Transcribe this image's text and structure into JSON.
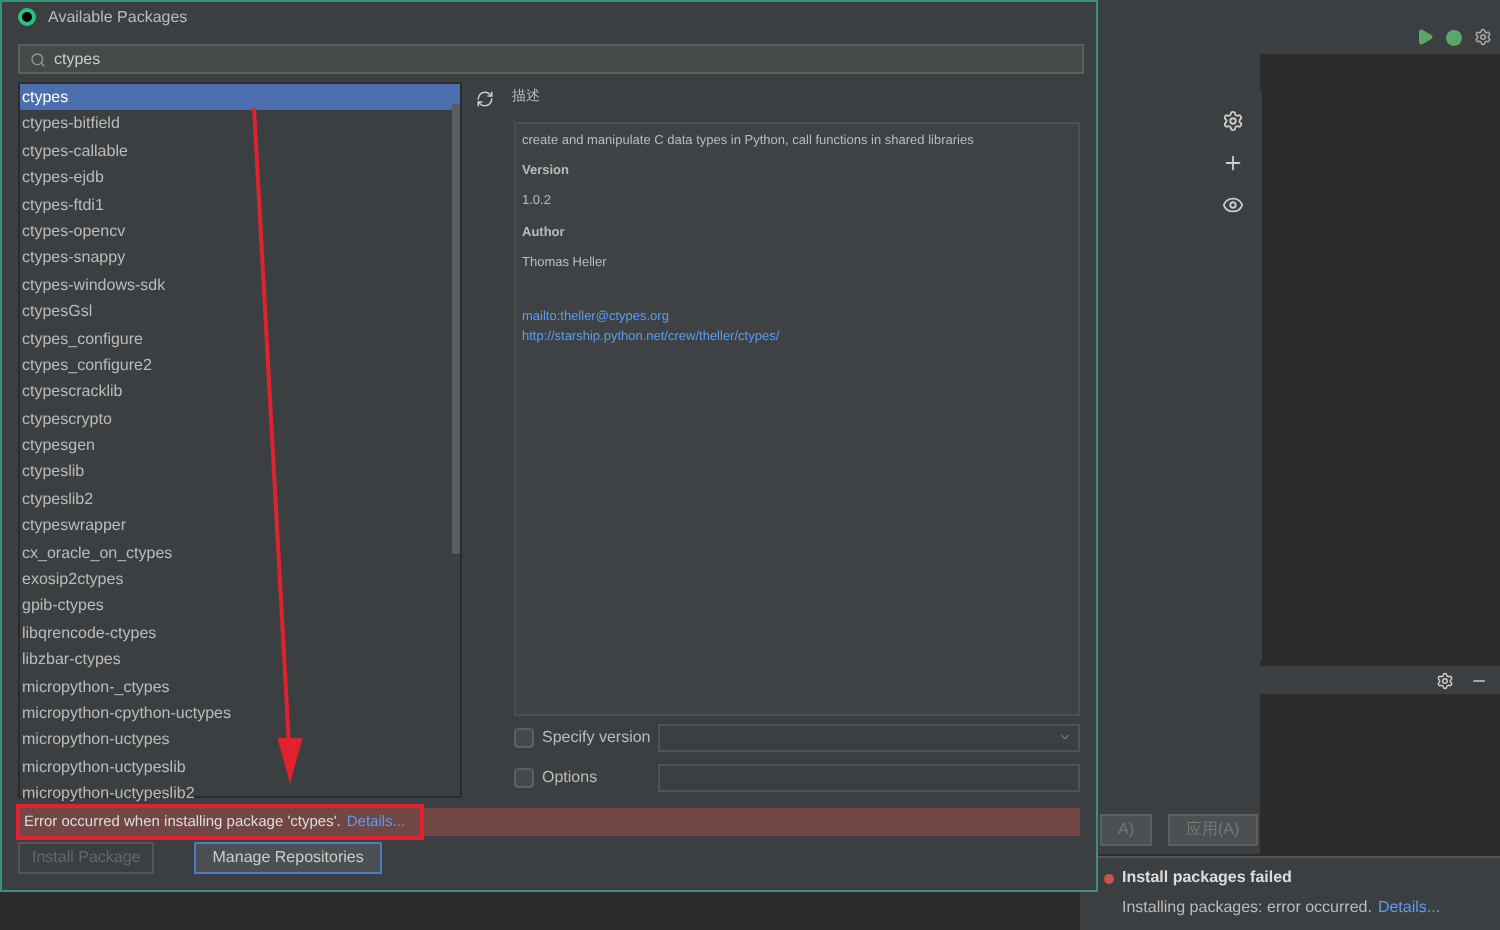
{
  "window": {
    "title": "Available Packages"
  },
  "search": {
    "value": "ctypes"
  },
  "packages": [
    {
      "name": "ctypes",
      "selected": true
    },
    {
      "name": "ctypes-bitfield",
      "selected": false
    },
    {
      "name": "ctypes-callable",
      "selected": false
    },
    {
      "name": "ctypes-ejdb",
      "selected": false
    },
    {
      "name": "ctypes-ftdi1",
      "selected": false
    },
    {
      "name": "ctypes-opencv",
      "selected": false
    },
    {
      "name": "ctypes-snappy",
      "selected": false
    },
    {
      "name": "ctypes-windows-sdk",
      "selected": false
    },
    {
      "name": "ctypesGsl",
      "selected": false
    },
    {
      "name": "ctypes_configure",
      "selected": false
    },
    {
      "name": "ctypes_configure2",
      "selected": false
    },
    {
      "name": "ctypescracklib",
      "selected": false
    },
    {
      "name": "ctypescrypto",
      "selected": false
    },
    {
      "name": "ctypesgen",
      "selected": false
    },
    {
      "name": "ctypeslib",
      "selected": false
    },
    {
      "name": "ctypeslib2",
      "selected": false
    },
    {
      "name": "ctypeswrapper",
      "selected": false
    },
    {
      "name": "cx_oracle_on_ctypes",
      "selected": false
    },
    {
      "name": "exosip2ctypes",
      "selected": false
    },
    {
      "name": "gpib-ctypes",
      "selected": false
    },
    {
      "name": "libqrencode-ctypes",
      "selected": false
    },
    {
      "name": "libzbar-ctypes",
      "selected": false
    },
    {
      "name": "micropython-_ctypes",
      "selected": false
    },
    {
      "name": "micropython-cpython-uctypes",
      "selected": false
    },
    {
      "name": "micropython-uctypes",
      "selected": false
    },
    {
      "name": "micropython-uctypeslib",
      "selected": false
    },
    {
      "name": "micropython-uctypeslib2",
      "selected": false
    }
  ],
  "description": {
    "header": "描述",
    "summary": "create and manipulate C data types in Python, call functions in shared libraries",
    "version_label": "Version",
    "version": "1.0.2",
    "author_label": "Author",
    "author": "Thomas Heller",
    "links": [
      "mailto:theller@ctypes.org",
      "http://starship.python.net/crew/theller/ctypes/"
    ]
  },
  "specify_version": {
    "label": "Specify version",
    "checked": false
  },
  "options": {
    "label": "Options",
    "checked": false
  },
  "error": {
    "message": "Error occurred when installing package 'ctypes'.",
    "link": "Details..."
  },
  "buttons": [
    {
      "label": "Install Package",
      "disabled": true
    },
    {
      "label": "Manage Repositories",
      "disabled": false
    }
  ],
  "background": {
    "buttons": [
      "A)",
      "应用(A)"
    ]
  },
  "notification": {
    "title": "Install packages failed",
    "message": "Installing packages: error occurred.",
    "link": "Details..."
  }
}
